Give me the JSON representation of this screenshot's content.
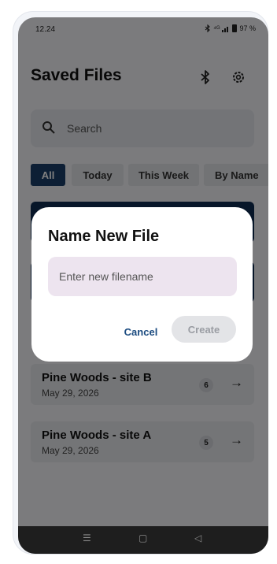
{
  "status_bar": {
    "time": "12.24",
    "signal": "⁴ᴳ",
    "battery": "97 %"
  },
  "header": {
    "title": "Saved Files",
    "bluetooth_icon": "bluetooth-icon",
    "settings_icon": "gear-icon"
  },
  "search": {
    "placeholder": "Search",
    "icon": "search-icon"
  },
  "filters": [
    "All",
    "Today",
    "This Week",
    "By Name"
  ],
  "filter_selected": "All",
  "files": [
    {
      "name": "",
      "date": "",
      "count": ""
    },
    {
      "name": "",
      "date": "",
      "count": ""
    },
    {
      "name": "Pine Woods - site B",
      "date": "May 29, 2026",
      "count": "6"
    },
    {
      "name": "Pine Woods - site A",
      "date": "May 29, 2026",
      "count": "5"
    }
  ],
  "dialog": {
    "title": "Name New File",
    "input_value": "",
    "input_placeholder": "Enter new filename",
    "cancel_label": "Cancel",
    "create_label": "Create"
  },
  "nav": {
    "recents": "☰",
    "home": "▢",
    "back": "◁"
  },
  "colors": {
    "accent": "#1b3f6a",
    "dialog_input": "#ede4ef",
    "scrim": "rgba(0,0,0,0.5)"
  }
}
